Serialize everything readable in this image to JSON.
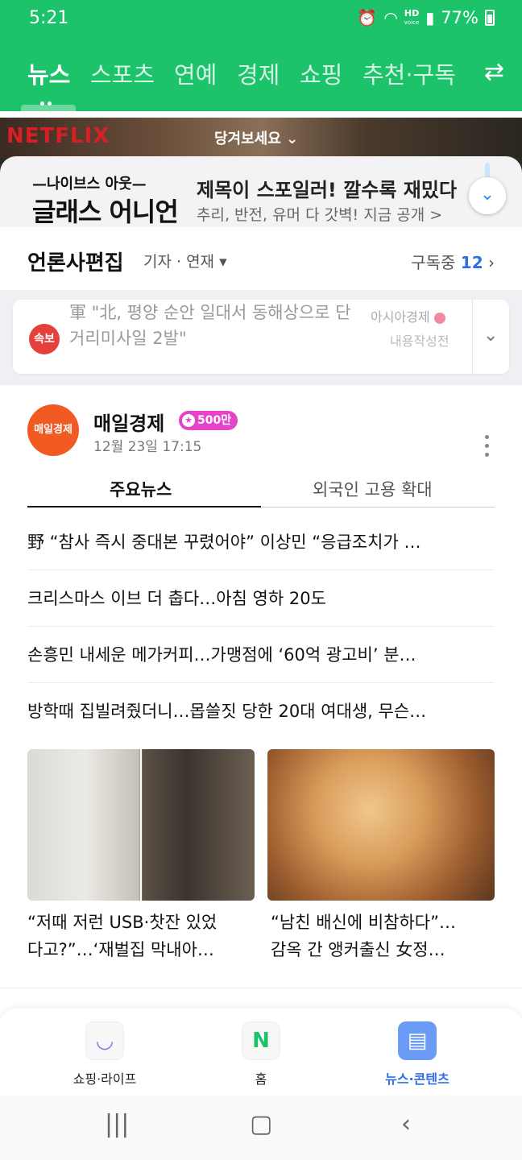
{
  "status": {
    "time": "5:21",
    "battery": "77%",
    "hd_label": "HD",
    "voice_label": "voice"
  },
  "tabs": [
    {
      "label": "뉴스"
    },
    {
      "label": "스포츠"
    },
    {
      "label": "연예"
    },
    {
      "label": "경제"
    },
    {
      "label": "쇼핑"
    },
    {
      "label": "추천·구독"
    }
  ],
  "ad": {
    "brand": "NETFLIX",
    "pull_label": "당겨보세요",
    "logo_top": "—나이브스 아웃—",
    "logo_main": "글래스 어니언",
    "headline": "제목이 스포일러! 깔수록 재밌다",
    "sub": "추리, 반전, 유머 다 갓벽! 지금 공개 >"
  },
  "press": {
    "title": "언론사편집",
    "meta": "기자 · 연재",
    "subs_label": "구독중",
    "subs_count": "12"
  },
  "breaking": {
    "badge": "속보",
    "text": "軍 \"北, 평양 순안 일대서 동해상으로 단거리미사일 2발\"",
    "source": "아시아경제",
    "status": "내용작성전"
  },
  "publisher": {
    "logo": "매일경제",
    "name": "매일경제",
    "subscribers": "500만",
    "time": "12월 23일 17:15",
    "subtabs": [
      "주요뉴스",
      "외국인 고용 확대"
    ]
  },
  "headlines": [
    "野 “참사 즉시 중대본 꾸렸어야” 이상민 “응급조치가 …",
    "크리스마스 이브 더 춥다…아침 영하 20도",
    "손흥민 내세운 메가커피…가맹점에 ‘60억 광고비’ 분…",
    "방학때 집빌려줬더니…몹쓸짓 당한 20대 여대생, 무슨…"
  ],
  "photo_news": [
    {
      "line1": "“저때 저런 USB·찻잔 있었",
      "line2": "다고?”…‘재벌집 막내아…"
    },
    {
      "line1": "“남친 배신에 비참하다”…",
      "line2": "감옥 간 앵커출신 女정…"
    }
  ],
  "bottom_nav": [
    {
      "label": "쇼핑·라이프",
      "icon": "shopping-bag-icon"
    },
    {
      "label": "홈",
      "icon": "naver-n-icon",
      "glyph": "N"
    },
    {
      "label": "뉴스·콘텐츠",
      "icon": "news-icon"
    }
  ],
  "colors": {
    "brand_green": "#1cc36a",
    "accent_blue": "#2f6ee8",
    "breaking_red": "#e5403c",
    "publisher_orange": "#f15a22",
    "subscriber_pink": "#e543c8"
  }
}
